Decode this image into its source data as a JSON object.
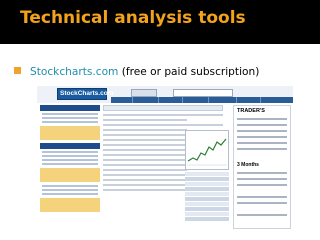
{
  "slide": {
    "title": "Technical analysis tools",
    "bullet": {
      "link_text": "Stockcharts.com",
      "rest_text": " (free or paid subscription)"
    }
  },
  "screenshot": {
    "logo": "StockCharts.com",
    "ad_title": "TRADER'S",
    "ad_subtitle": "3 Months"
  },
  "colors": {
    "title": "#f3a21b",
    "bullet": "#f0a32a",
    "link": "#1f8fb0",
    "nav": "#2a5c98"
  }
}
